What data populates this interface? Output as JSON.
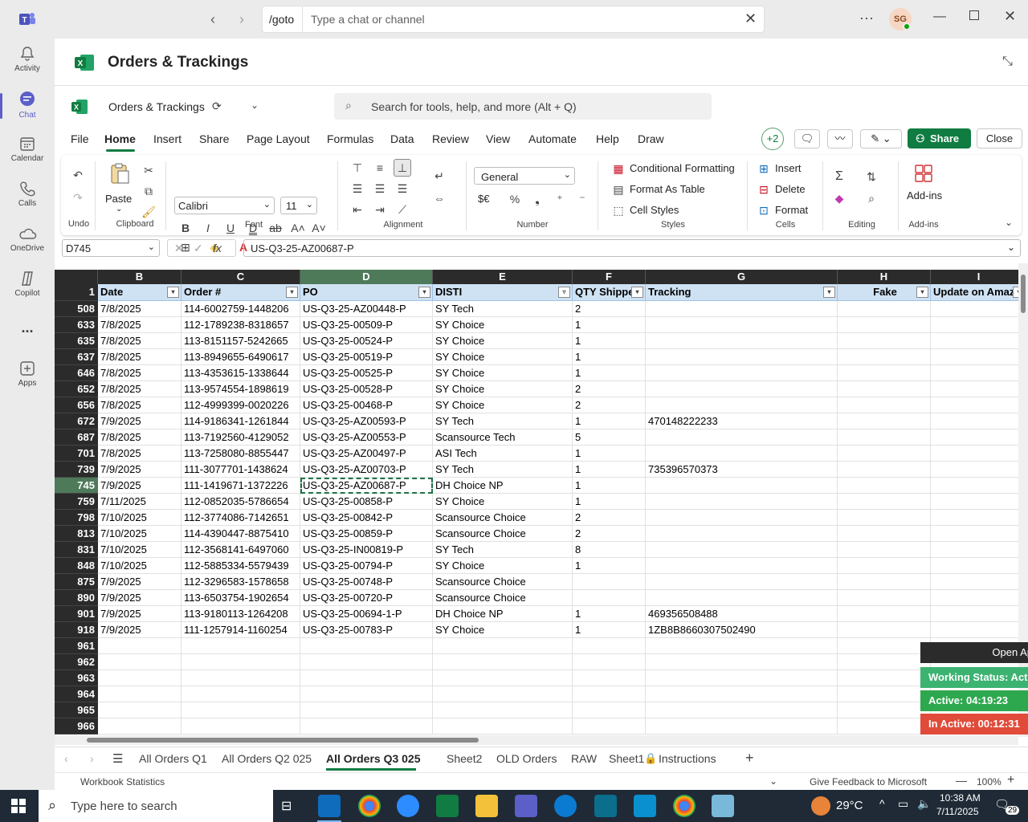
{
  "teams": {
    "goto_label": "/goto",
    "search_placeholder": "Type a chat or channel",
    "avatar_initials": "SG",
    "rail": [
      {
        "label": "Activity"
      },
      {
        "label": "Chat"
      },
      {
        "label": "Calendar"
      },
      {
        "label": "Calls"
      },
      {
        "label": "OneDrive"
      },
      {
        "label": "Copilot"
      },
      {
        "label": "..."
      },
      {
        "label": "Apps"
      }
    ]
  },
  "app": {
    "title": "Orders & Trackings",
    "doc_name": "Orders & Trackings",
    "search_placeholder": "Search for tools, help, and more (Alt + Q)"
  },
  "menu": {
    "items": [
      "File",
      "Home",
      "Insert",
      "Share",
      "Page Layout",
      "Formulas",
      "Data",
      "Review",
      "View",
      "Automate",
      "Help",
      "Draw"
    ],
    "active": "Home",
    "collab_count": "+2",
    "share_label": "Share",
    "close_label": "Close"
  },
  "ribbon": {
    "undo_group": "Undo",
    "paste_label": "Paste",
    "clipboard_group": "Clipboard",
    "font_name": "Calibri",
    "font_size": "11",
    "font_group": "Font",
    "alignment_group": "Alignment",
    "number_format": "General",
    "number_group": "Number",
    "conditional_formatting": "Conditional Formatting",
    "format_as_table": "Format As Table",
    "cell_styles": "Cell Styles",
    "styles_group": "Styles",
    "insert": "Insert",
    "delete": "Delete",
    "format": "Format",
    "cells_group": "Cells",
    "editing_group": "Editing",
    "addins": "Add-ins",
    "addins_group": "Add-ins",
    "currency_symbol": "$€"
  },
  "formula_bar": {
    "name_box": "D745",
    "fx": "fx",
    "value": "US-Q3-25-AZ00687-P"
  },
  "grid": {
    "columns": [
      "B",
      "C",
      "D",
      "E",
      "F",
      "G",
      "H",
      "I"
    ],
    "header_row_num": "1",
    "headers": [
      "Date",
      "Order #",
      "PO",
      "DISTI",
      "QTY Shipped",
      "Tracking",
      "Fake",
      "Update on Amazon"
    ],
    "rows": [
      {
        "n": "508",
        "date": "7/8/2025",
        "order": "114-6002759-1448206",
        "po": "US-Q3-25-AZ00448-P",
        "disti": "SY Tech",
        "qty": "2",
        "tracking": ""
      },
      {
        "n": "633",
        "date": "7/8/2025",
        "order": "112-1789238-8318657",
        "po": "US-Q3-25-00509-P",
        "disti": "SY Choice",
        "qty": "1",
        "tracking": ""
      },
      {
        "n": "635",
        "date": "7/8/2025",
        "order": "113-8151157-5242665",
        "po": "US-Q3-25-00524-P",
        "disti": "SY Choice",
        "qty": "1",
        "tracking": ""
      },
      {
        "n": "637",
        "date": "7/8/2025",
        "order": "113-8949655-6490617",
        "po": "US-Q3-25-00519-P",
        "disti": "SY Choice",
        "qty": "1",
        "tracking": ""
      },
      {
        "n": "646",
        "date": "7/8/2025",
        "order": "113-4353615-1338644",
        "po": "US-Q3-25-00525-P",
        "disti": "SY Choice",
        "qty": "1",
        "tracking": ""
      },
      {
        "n": "652",
        "date": "7/8/2025",
        "order": "113-9574554-1898619",
        "po": "US-Q3-25-00528-P",
        "disti": "SY Choice",
        "qty": "2",
        "tracking": ""
      },
      {
        "n": "656",
        "date": "7/8/2025",
        "order": "112-4999399-0020226",
        "po": "US-Q3-25-00468-P",
        "disti": "SY Choice",
        "qty": "2",
        "tracking": ""
      },
      {
        "n": "672",
        "date": "7/9/2025",
        "order": "114-9186341-1261844",
        "po": "US-Q3-25-AZ00593-P",
        "disti": "SY Tech",
        "qty": "1",
        "tracking": "470148222233"
      },
      {
        "n": "687",
        "date": "7/8/2025",
        "order": "113-7192560-4129052",
        "po": "US-Q3-25-AZ00553-P",
        "disti": "Scansource Tech",
        "qty": "5",
        "tracking": ""
      },
      {
        "n": "701",
        "date": "7/8/2025",
        "order": "113-7258080-8855447",
        "po": "US-Q3-25-AZ00497-P",
        "disti": "ASI Tech",
        "qty": "1",
        "tracking": ""
      },
      {
        "n": "739",
        "date": "7/9/2025",
        "order": "111-3077701-1438624",
        "po": "US-Q3-25-AZ00703-P",
        "disti": "SY Tech",
        "qty": "1",
        "tracking": "735396570373"
      },
      {
        "n": "745",
        "date": "7/9/2025",
        "order": "111-1419671-1372226",
        "po": "US-Q3-25-AZ00687-P",
        "disti": "DH Choice NP",
        "qty": "1",
        "tracking": ""
      },
      {
        "n": "759",
        "date": "7/11/2025",
        "order": "112-0852035-5786654",
        "po": "US-Q3-25-00858-P",
        "disti": "SY Choice",
        "qty": "1",
        "tracking": ""
      },
      {
        "n": "798",
        "date": "7/10/2025",
        "order": "112-3774086-7142651",
        "po": "US-Q3-25-00842-P",
        "disti": "Scansource Choice",
        "qty": "2",
        "tracking": ""
      },
      {
        "n": "813",
        "date": "7/10/2025",
        "order": "114-4390447-8875410",
        "po": "US-Q3-25-00859-P",
        "disti": "Scansource Choice",
        "qty": "2",
        "tracking": ""
      },
      {
        "n": "831",
        "date": "7/10/2025",
        "order": "112-3568141-6497060",
        "po": "US-Q3-25-IN00819-P",
        "disti": "SY Tech",
        "qty": "8",
        "tracking": ""
      },
      {
        "n": "848",
        "date": "7/10/2025",
        "order": "112-5885334-5579439",
        "po": "US-Q3-25-00794-P",
        "disti": "SY Choice",
        "qty": "1",
        "tracking": ""
      },
      {
        "n": "875",
        "date": "7/9/2025",
        "order": "112-3296583-1578658",
        "po": "US-Q3-25-00748-P",
        "disti": "Scansource Choice",
        "qty": "",
        "tracking": ""
      },
      {
        "n": "890",
        "date": "7/9/2025",
        "order": "113-6503754-1902654",
        "po": "US-Q3-25-00720-P",
        "disti": "Scansource Choice",
        "qty": "",
        "tracking": ""
      },
      {
        "n": "901",
        "date": "7/9/2025",
        "order": "113-9180113-1264208",
        "po": "US-Q3-25-00694-1-P",
        "disti": "DH Choice NP",
        "qty": "1",
        "tracking": "469356508488"
      },
      {
        "n": "918",
        "date": "7/9/2025",
        "order": "111-1257914-1160254",
        "po": "US-Q3-25-00783-P",
        "disti": "SY Choice",
        "qty": "1",
        "tracking": "1ZB8B8660307502490"
      },
      {
        "n": "961"
      },
      {
        "n": "962"
      },
      {
        "n": "963"
      },
      {
        "n": "964"
      },
      {
        "n": "965"
      },
      {
        "n": "966"
      }
    ],
    "selected_row": "745"
  },
  "overlay": {
    "open_label": "Open Ap",
    "working_status": "Working Status: Active",
    "active": "Active: 04:19:23",
    "inactive": "In Active: 00:12:31",
    "colors": {
      "working": "#3cb371",
      "active": "#2ea84f",
      "inactive": "#e04b3a"
    }
  },
  "sheets": {
    "tabs": [
      "All Orders Q1",
      "All Orders Q2 025",
      "All Orders Q3 025",
      "Sheet2",
      "OLD Orders",
      "RAW",
      "Sheet1",
      "Instructions"
    ],
    "active": "All Orders Q3 025"
  },
  "status": {
    "workbook_stats": "Workbook Statistics",
    "feedback": "Give Feedback to Microsoft",
    "zoom": "100%"
  },
  "taskbar": {
    "search_placeholder": "Type here to search",
    "temperature": "29°C",
    "time": "10:38 AM",
    "date": "7/11/2025",
    "notification_count": "29"
  },
  "colors": {
    "accent_teams": "#5b5fc7",
    "excel_green": "#107c41",
    "table_header": "#cfe2f3",
    "grid_header": "#2b2b2b"
  }
}
